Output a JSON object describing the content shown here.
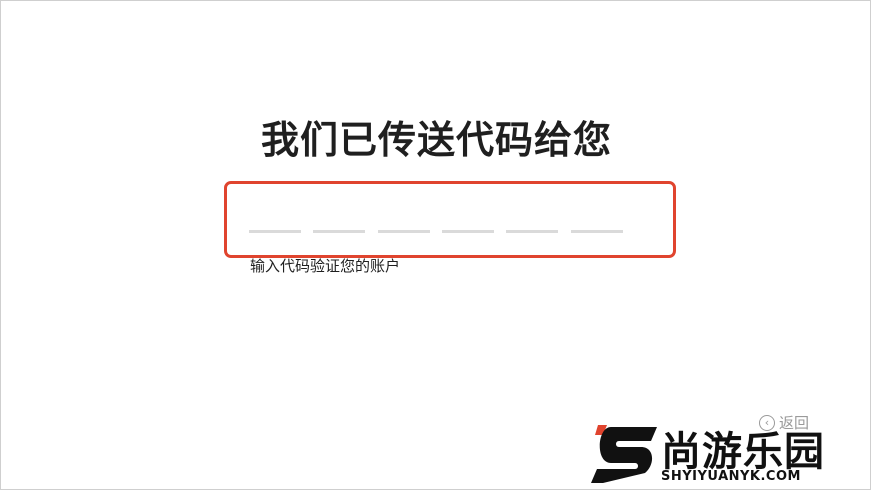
{
  "page": {
    "title": "我们已传送代码给您",
    "helper_text": "输入代码验证您的账户",
    "back_label": "返回"
  },
  "code_input": {
    "digits": [
      "",
      "",
      "",
      "",
      "",
      ""
    ],
    "highlight_color": "#e0442e"
  },
  "watermark": {
    "logo_letter": "S",
    "site_name": "尚游乐园",
    "url": "SHYIYUANYK.COM"
  }
}
